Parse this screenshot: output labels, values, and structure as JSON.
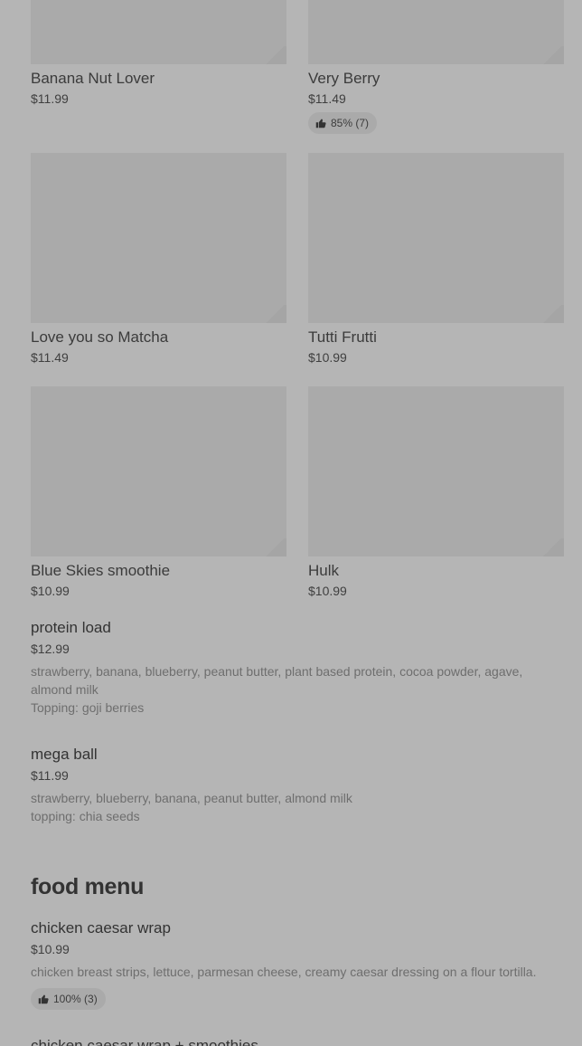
{
  "smoothies": [
    {
      "name": "Banana Nut Lover",
      "price": "$11.99"
    },
    {
      "name": "Very Berry",
      "price": "$11.49",
      "rating": "85% (7)"
    },
    {
      "name": "Love you so Matcha",
      "price": "$11.49"
    },
    {
      "name": "Tutti Frutti",
      "price": "$10.99"
    },
    {
      "name": "Blue Skies smoothie",
      "price": "$10.99"
    },
    {
      "name": "Hulk",
      "price": "$10.99"
    }
  ],
  "list_items": [
    {
      "title": "protein load",
      "price": "$12.99",
      "desc_line1": "strawberry, banana, blueberry, peanut butter, plant based protein, cocoa powder, agave, almond milk",
      "desc_line2": "Topping: goji berries"
    },
    {
      "title": "mega ball",
      "price": "$11.99",
      "desc_line1": "strawberry, blueberry, banana, peanut butter, almond milk",
      "desc_line2": "topping: chia seeds"
    }
  ],
  "food_menu": {
    "heading": "food menu",
    "items": [
      {
        "title": "chicken caesar wrap",
        "price": "$10.99",
        "desc": "chicken breast strips, lettuce, parmesan cheese, creamy caesar dressing on a flour tortilla.",
        "rating": "100% (3)"
      },
      {
        "title": "chicken caesar wrap + smoothies"
      }
    ]
  },
  "icons": {
    "rating": "thumbs-up-icon"
  }
}
